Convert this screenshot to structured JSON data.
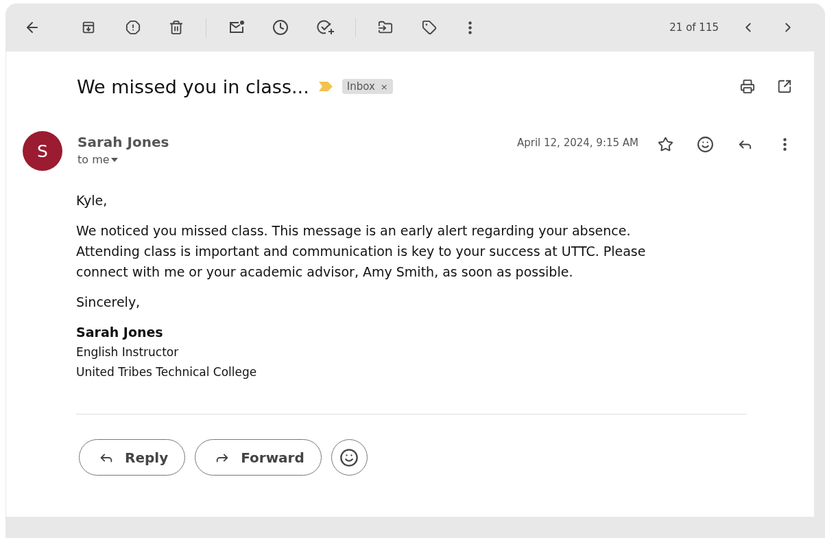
{
  "toolbar": {
    "counter": "21 of 115"
  },
  "subject": "We missed you in class...",
  "important": true,
  "labels": [
    {
      "text": "Inbox",
      "remove": "×"
    }
  ],
  "message": {
    "avatar_letter": "S",
    "sender": "Sarah Jones",
    "recipient": "to me",
    "date": "April 12, 2024, 9:15 AM",
    "starred": false,
    "greeting": "Kyle,",
    "body": "We noticed you missed class. This message is an early alert regarding your absence. Attending class is important and communication is key to your success at UTTC. Please connect with me or your academic advisor, Amy Smith, as soon as possible.",
    "closing": "Sincerely,",
    "signature": {
      "name": "Sarah Jones",
      "lines": [
        "English Instructor",
        "United Tribes Technical College"
      ]
    }
  },
  "actions": [
    {
      "kind": "reply",
      "label": "Reply"
    },
    {
      "kind": "forward",
      "label": "Forward"
    },
    {
      "kind": "emoji"
    }
  ]
}
